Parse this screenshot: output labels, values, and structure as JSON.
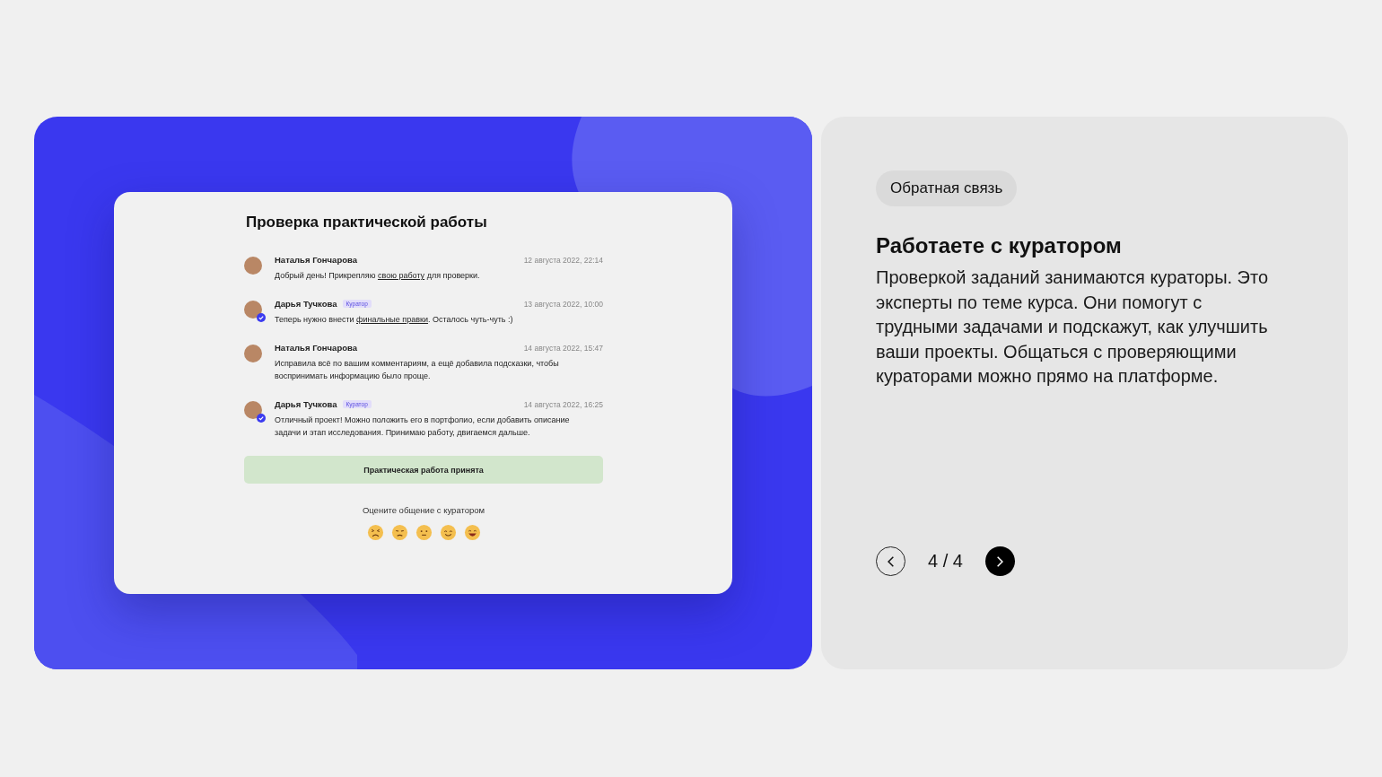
{
  "preview": {
    "title": "Проверка практической работы",
    "messages": [
      {
        "author": "Наталья Гончарова",
        "verified": false,
        "date": "12 августа 2022, 22:14",
        "text_before": "Добрый день! Прикрепляю ",
        "link": "свою работу",
        "text_after": " для проверки."
      },
      {
        "author": "Дарья Тучкова",
        "role": "Куратор",
        "verified": true,
        "date": "13 августа 2022, 10:00",
        "text_before": "Теперь нужно внести ",
        "link": "финальные правки",
        "text_after": ". Осталось чуть-чуть :)"
      },
      {
        "author": "Наталья Гончарова",
        "verified": false,
        "date": "14 августа 2022, 15:47",
        "text_before": "Исправила всё по вашим комментариям, а ещё добавила подсказки, чтобы воспринимать информацию было проще."
      },
      {
        "author": "Дарья Тучкова",
        "role": "Куратор",
        "verified": true,
        "date": "14 августа 2022, 16:25",
        "text_before": "Отличный проект! Можно положить его в портфолио, если добавить описание задачи и этап исследования. Принимаю работу, двигаемся дальше."
      }
    ],
    "status": "Практическая работа принята",
    "rating_prompt": "Оцените общение с куратором"
  },
  "info": {
    "tag": "Обратная связь",
    "heading": "Работаете с куратором",
    "body": "Проверкой заданий занимаются кураторы. Это эксперты по теме курса. Они помогут с трудными задачами и подскажут, как улучшить ваши проекты. Общаться с проверяющими кураторами можно прямо на платформе.",
    "pager": "4 / 4"
  }
}
